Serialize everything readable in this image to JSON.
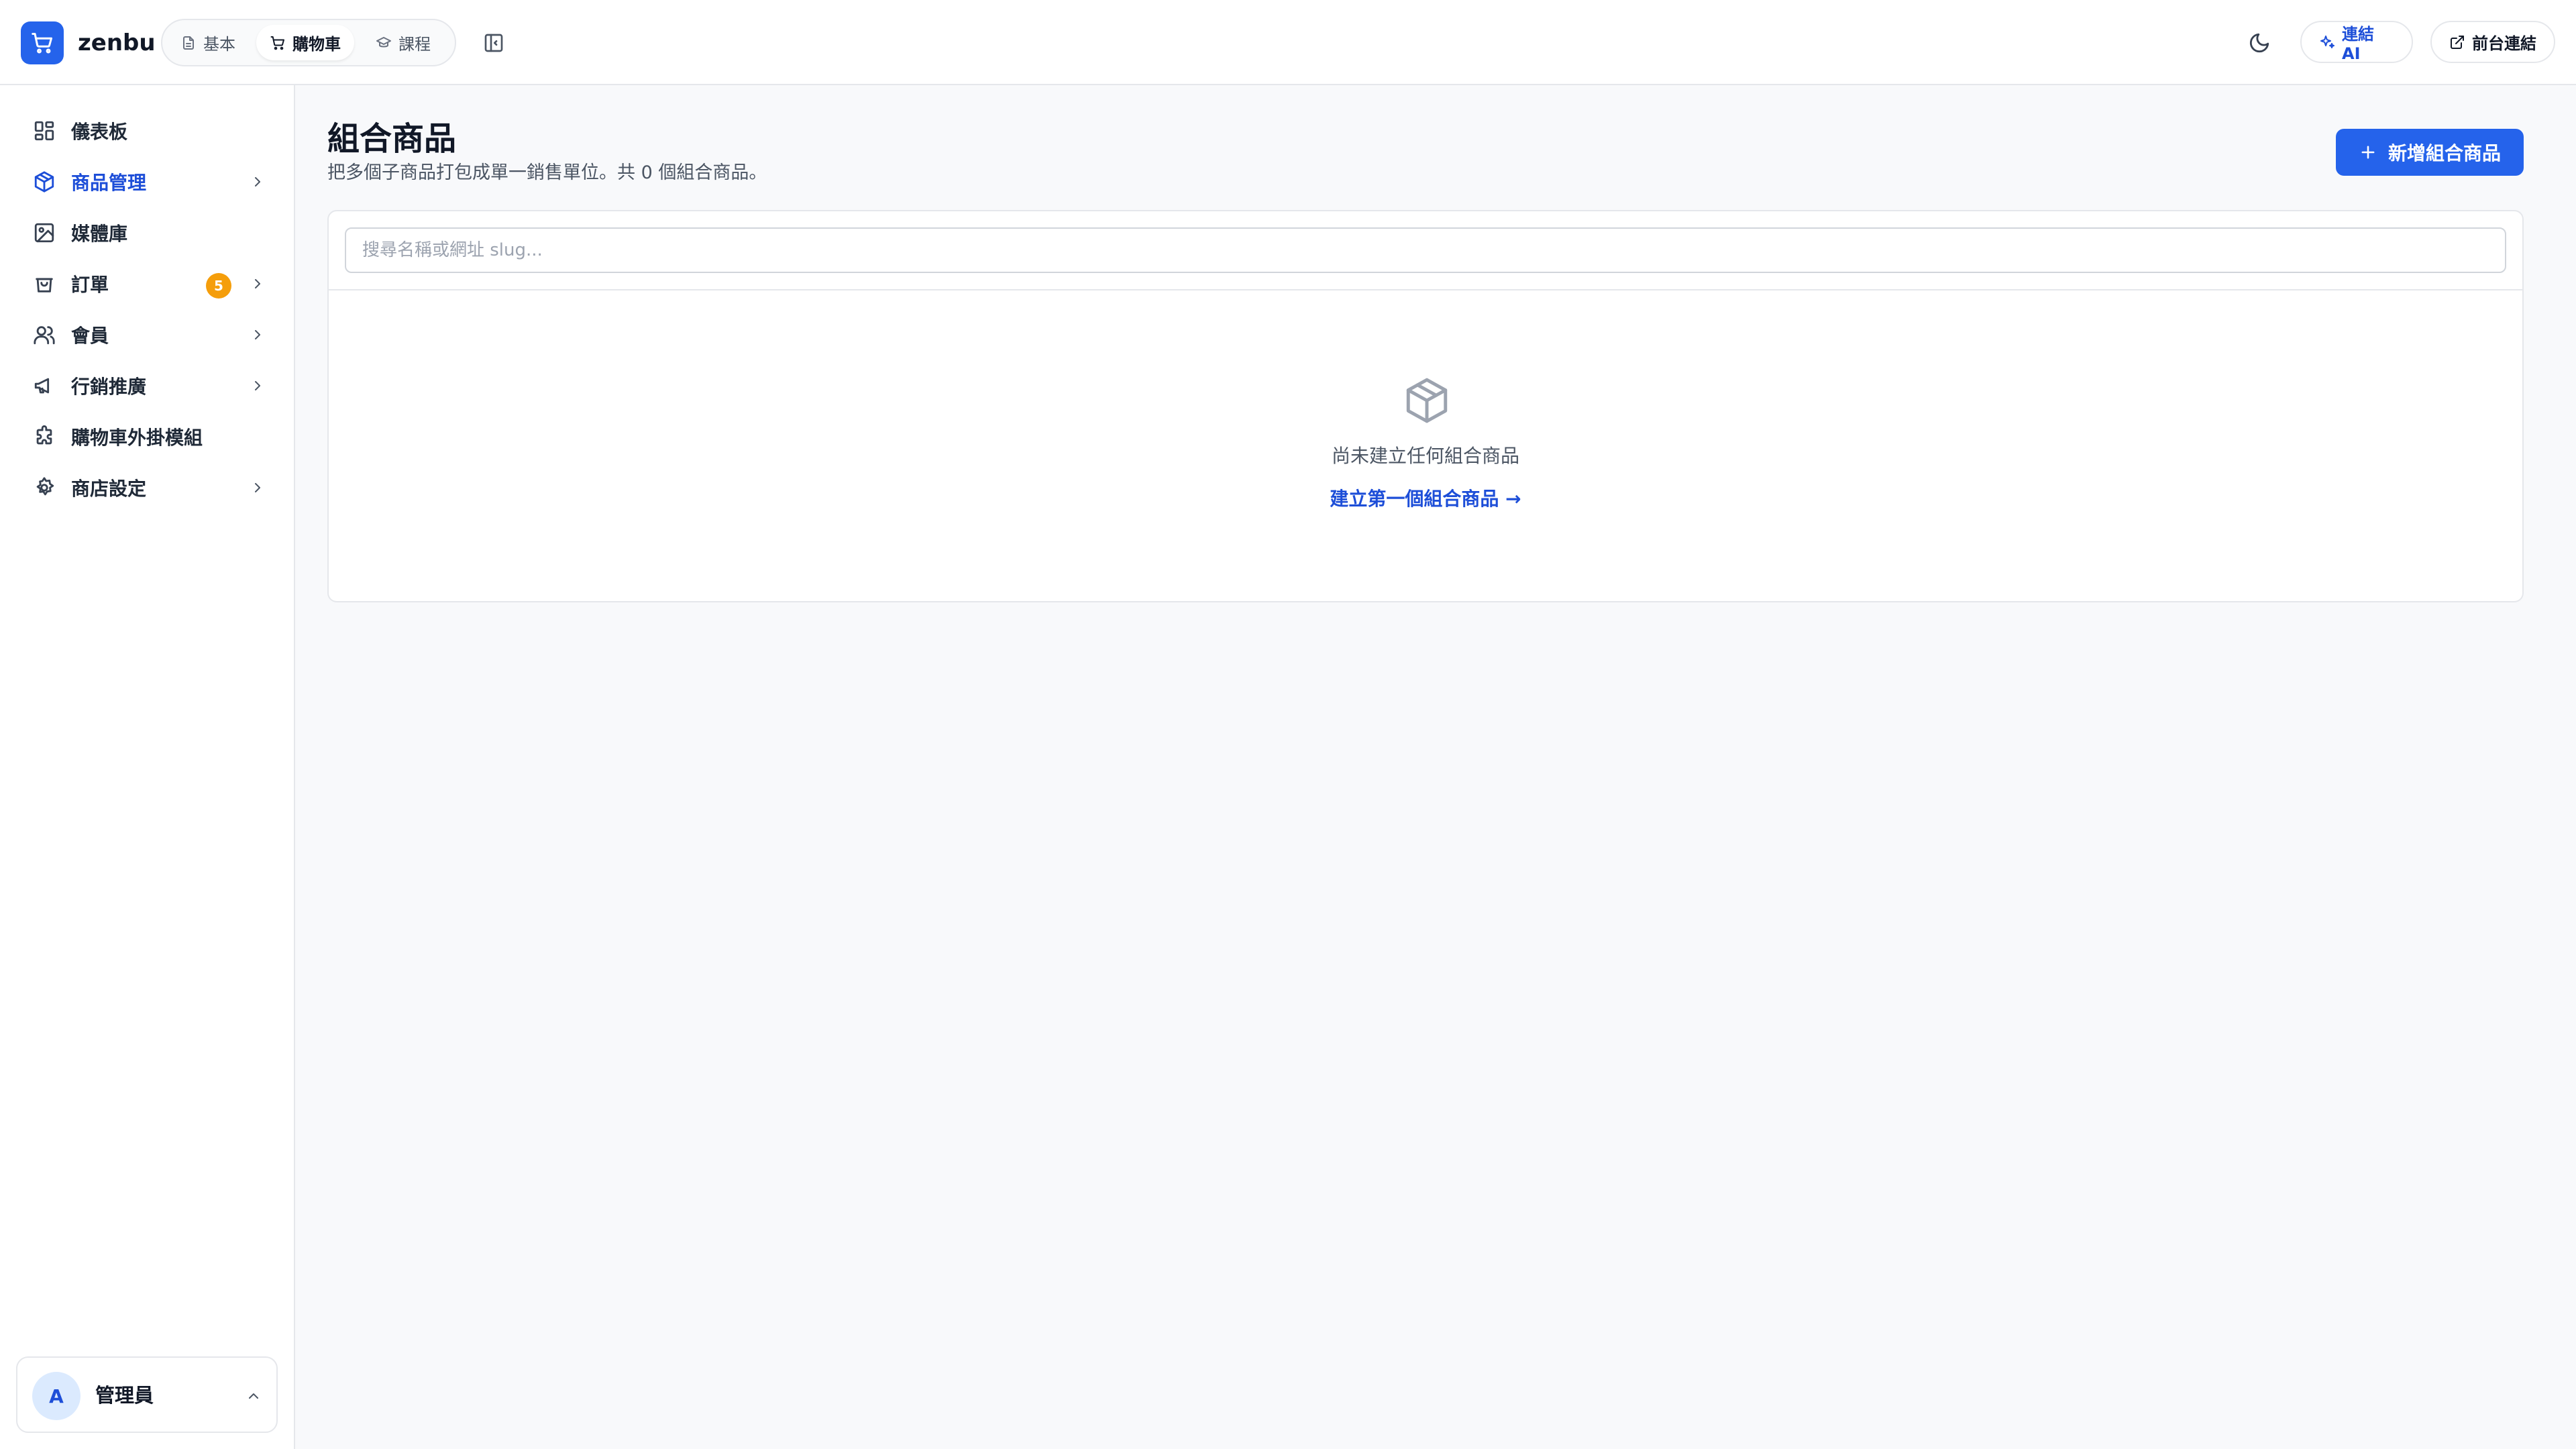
{
  "header": {
    "brand": "zenbu",
    "tabs": [
      {
        "label": "基本",
        "icon": "file-icon"
      },
      {
        "label": "購物車",
        "icon": "cart-icon",
        "active": true
      },
      {
        "label": "課程",
        "icon": "graduation-cap-icon"
      }
    ],
    "connect_ai_label": "連結 AI",
    "front_link_label": "前台連結"
  },
  "sidebar": {
    "items": [
      {
        "label": "儀表板",
        "icon": "dashboard-icon",
        "has_submenu": false
      },
      {
        "label": "商品管理",
        "icon": "box-icon",
        "has_submenu": true,
        "active": true
      },
      {
        "label": "媒體庫",
        "icon": "image-icon",
        "has_submenu": false
      },
      {
        "label": "訂單",
        "icon": "shopping-bag-icon",
        "has_submenu": true,
        "badge": "5"
      },
      {
        "label": "會員",
        "icon": "users-icon",
        "has_submenu": true
      },
      {
        "label": "行銷推廣",
        "icon": "megaphone-icon",
        "has_submenu": true
      },
      {
        "label": "購物車外掛模組",
        "icon": "puzzle-icon",
        "has_submenu": false
      },
      {
        "label": "商店設定",
        "icon": "gear-icon",
        "has_submenu": true
      }
    ],
    "user": {
      "initial": "A",
      "name": "管理員"
    }
  },
  "main": {
    "title": "組合商品",
    "subtitle": "把多個子商品打包成單一銷售單位。共 0 個組合商品。",
    "add_button_label": "新增組合商品",
    "search_placeholder": "搜尋名稱或網址 slug...",
    "empty_message": "尚未建立任何組合商品",
    "empty_cta": "建立第一個組合商品 →"
  },
  "colors": {
    "accent": "#2563eb",
    "accent_text": "#1d4ed8",
    "badge": "#f59e0b",
    "border": "#e5e7eb",
    "page_bg": "#f8f9fb"
  }
}
